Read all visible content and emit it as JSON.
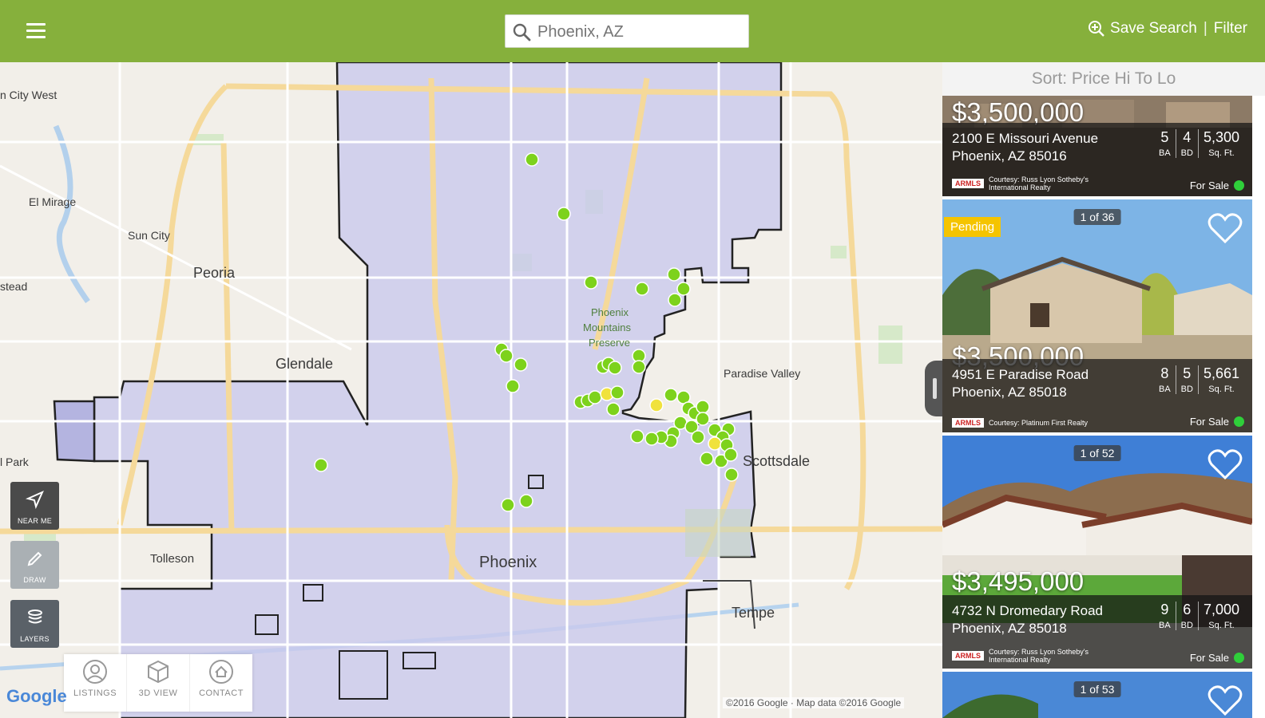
{
  "header": {
    "search_placeholder": "Phoenix, AZ",
    "save_search_label": "Save Search",
    "filter_label": "Filter",
    "separator": "|"
  },
  "map": {
    "labels": {
      "el_mirage": "El Mirage",
      "sun_city": "Sun City",
      "peoria": "Peoria",
      "glendale": "Glendale",
      "tolleson": "Tolleson",
      "phoenix": "Phoenix",
      "paradise_valley": "Paradise Valley",
      "scottsdale": "Scottsdale",
      "tempe": "Tempe",
      "pmp1": "Phoenix",
      "pmp2": "Mountains",
      "pmp3": "Preserve",
      "city_west": "n City West",
      "stead": "stead",
      "park": "l Park"
    },
    "controls": [
      {
        "key": "near_me",
        "label": "NEAR ME"
      },
      {
        "key": "draw",
        "label": "DRAW"
      },
      {
        "key": "layers",
        "label": "LAYERS"
      }
    ],
    "bottom_nav": [
      {
        "key": "listings",
        "label": "LISTINGS"
      },
      {
        "key": "3d_view",
        "label": "3D VIEW"
      },
      {
        "key": "contact",
        "label": "CONTACT"
      }
    ],
    "google_logo": "Google",
    "copyright": "©2016 Google · Map data ©2016 Google",
    "marker_color": "#7dd21c",
    "marker_alt_color": "#f0e23c"
  },
  "sidebar": {
    "sort_label": "Sort: Price Hi To Lo",
    "listings": [
      {
        "price": "$3,500,000",
        "address_line1": "2100 E Missouri Avenue",
        "address_line2": "Phoenix, AZ 85016",
        "baths": "5",
        "beds": "4",
        "sqft": "5,300",
        "unit_ba": "BA",
        "unit_bd": "BD",
        "unit_sqft": "Sq. Ft.",
        "courtesy": "Courtesy: Russ Lyon Sotheby's International Realty",
        "mls_logo": "ARMLS",
        "status": "For Sale"
      },
      {
        "price": "$3,500,000",
        "badge": "Pending",
        "photo_count": "1 of 36",
        "address_line1": "4951 E Paradise Road",
        "address_line2": "Phoenix, AZ 85018",
        "baths": "8",
        "beds": "5",
        "sqft": "5,661",
        "unit_ba": "BA",
        "unit_bd": "BD",
        "unit_sqft": "Sq. Ft.",
        "courtesy": "Courtesy: Platinum First Realty",
        "mls_logo": "ARMLS",
        "status": "For Sale"
      },
      {
        "price": "$3,495,000",
        "photo_count": "1 of 52",
        "address_line1": "4732 N Dromedary Road",
        "address_line2": "Phoenix, AZ 85018",
        "baths": "9",
        "beds": "6",
        "sqft": "7,000",
        "unit_ba": "BA",
        "unit_bd": "BD",
        "unit_sqft": "Sq. Ft.",
        "courtesy": "Courtesy: Russ Lyon Sotheby's International Realty",
        "mls_logo": "ARMLS",
        "status": "For Sale"
      },
      {
        "photo_count": "1 of 53"
      }
    ]
  },
  "colors": {
    "header_green": "#86b03c",
    "boundary_fill": "#c9c9ec",
    "status_green": "#2fcf3a",
    "pending_yellow": "#f5c400"
  }
}
